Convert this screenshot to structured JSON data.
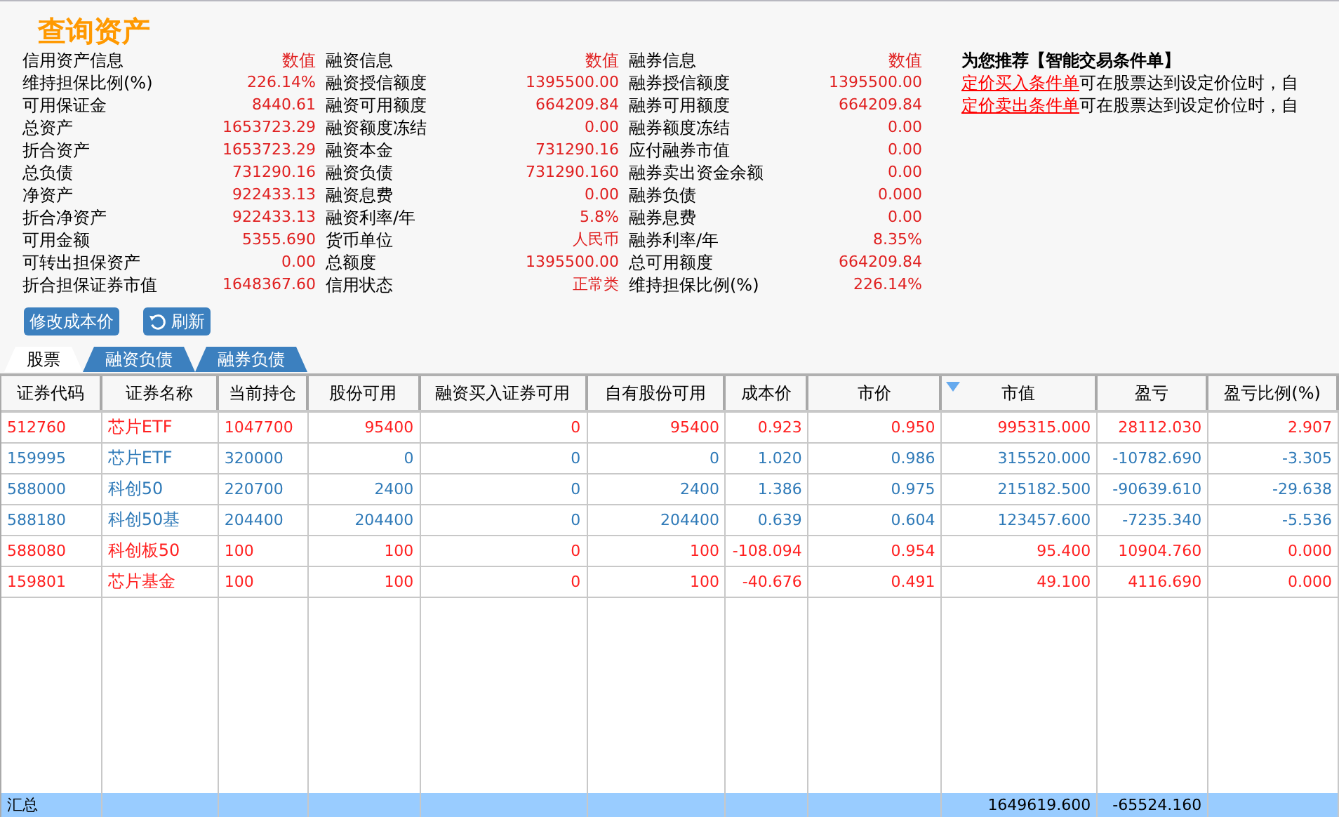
{
  "title": "查询资产",
  "info_columns": [
    {
      "header": "信用资产信息",
      "header_value": "数值",
      "rows": [
        {
          "label": "维持担保比例(%)",
          "value": "226.14%"
        },
        {
          "label": "可用保证金",
          "value": "8440.61"
        },
        {
          "label": "总资产",
          "value": "1653723.29"
        },
        {
          "label": "折合资产",
          "value": "1653723.29"
        },
        {
          "label": "总负债",
          "value": "731290.16"
        },
        {
          "label": "净资产",
          "value": "922433.13"
        },
        {
          "label": "折合净资产",
          "value": "922433.13"
        },
        {
          "label": "可用金额",
          "value": "5355.690"
        },
        {
          "label": "可转出担保资产",
          "value": "0.00"
        },
        {
          "label": "折合担保证券市值",
          "value": "1648367.60"
        }
      ]
    },
    {
      "header": "融资信息",
      "header_value": "数值",
      "rows": [
        {
          "label": "融资授信额度",
          "value": "1395500.00"
        },
        {
          "label": "融资可用额度",
          "value": "664209.84"
        },
        {
          "label": "融资额度冻结",
          "value": "0.00"
        },
        {
          "label": "融资本金",
          "value": "731290.16"
        },
        {
          "label": "融资负债",
          "value": "731290.160"
        },
        {
          "label": "融资息费",
          "value": "0.00"
        },
        {
          "label": "融资利率/年",
          "value": "5.8%"
        },
        {
          "label": "货币单位",
          "value": "人民币"
        },
        {
          "label": "总额度",
          "value": "1395500.00"
        },
        {
          "label": "信用状态",
          "value": "正常类"
        }
      ]
    },
    {
      "header": "融券信息",
      "header_value": "数值",
      "rows": [
        {
          "label": "融券授信额度",
          "value": "1395500.00"
        },
        {
          "label": "融券可用额度",
          "value": "664209.84"
        },
        {
          "label": "融券额度冻结",
          "value": "0.00"
        },
        {
          "label": "应付融券市值",
          "value": "0.00"
        },
        {
          "label": "融券卖出资金余额",
          "value": "0.00"
        },
        {
          "label": "融券负债",
          "value": "0.000"
        },
        {
          "label": "融券息费",
          "value": "0.00"
        },
        {
          "label": "融券利率/年",
          "value": "8.35%"
        },
        {
          "label": "总可用额度",
          "value": "664209.84"
        },
        {
          "label": "维持担保比例(%)",
          "value": "226.14%"
        }
      ]
    }
  ],
  "recommend": {
    "title": "为您推荐【智能交易条件单】",
    "lines": [
      {
        "link": "定价买入条件单",
        "text": "可在股票达到设定价位时，自"
      },
      {
        "link": "定价卖出条件单",
        "text": "可在股票达到设定价位时，自"
      }
    ]
  },
  "buttons": [
    {
      "label": "修改成本价",
      "kind": "plain"
    },
    {
      "label": "刷新",
      "kind": "refresh"
    }
  ],
  "tabs": [
    {
      "label": "股票",
      "selected": true
    },
    {
      "label": "融资负债",
      "selected": false
    },
    {
      "label": "融券负债",
      "selected": false
    }
  ],
  "table": {
    "columns": [
      {
        "label": "证券代码",
        "sorted": false
      },
      {
        "label": "证券名称",
        "sorted": false
      },
      {
        "label": "当前持仓",
        "sorted": false
      },
      {
        "label": "股份可用",
        "sorted": false
      },
      {
        "label": "融资买入证券可用",
        "sorted": false
      },
      {
        "label": "自有股份可用",
        "sorted": false
      },
      {
        "label": "成本价",
        "sorted": false
      },
      {
        "label": "市价",
        "sorted": false
      },
      {
        "label": "市值",
        "sorted": true
      },
      {
        "label": "盈亏",
        "sorted": false
      },
      {
        "label": "盈亏比例(%)",
        "sorted": false
      }
    ],
    "rows": [
      {
        "color": "#ff2020",
        "cells": [
          "512760",
          "芯片ETF",
          "1047700",
          "95400",
          "0",
          "95400",
          "0.923",
          "0.950",
          "995315.000",
          "28112.030",
          "2.907"
        ]
      },
      {
        "color": "#2f7ab8",
        "cells": [
          "159995",
          "芯片ETF",
          "320000",
          "0",
          "0",
          "0",
          "1.020",
          "0.986",
          "315520.000",
          "-10782.690",
          "-3.305"
        ]
      },
      {
        "color": "#2f7ab8",
        "cells": [
          "588000",
          "科创50",
          "220700",
          "2400",
          "0",
          "2400",
          "1.386",
          "0.975",
          "215182.500",
          "-90639.610",
          "-29.638"
        ]
      },
      {
        "color": "#2f7ab8",
        "cells": [
          "588180",
          "科创50基",
          "204400",
          "204400",
          "0",
          "204400",
          "0.639",
          "0.604",
          "123457.600",
          "-7235.340",
          "-5.536"
        ]
      },
      {
        "color": "#ff2020",
        "cells": [
          "588080",
          "科创板50",
          "100",
          "100",
          "0",
          "100",
          "-108.094",
          "0.954",
          "95.400",
          "10904.760",
          "0.000"
        ]
      },
      {
        "color": "#ff2020",
        "cells": [
          "159801",
          "芯片基金",
          "100",
          "100",
          "0",
          "100",
          "-40.676",
          "0.491",
          "49.100",
          "4116.690",
          "0.000"
        ]
      }
    ],
    "summary": {
      "label": "汇总",
      "market_value": "1649619.600",
      "profit_loss": "-65524.160"
    }
  }
}
